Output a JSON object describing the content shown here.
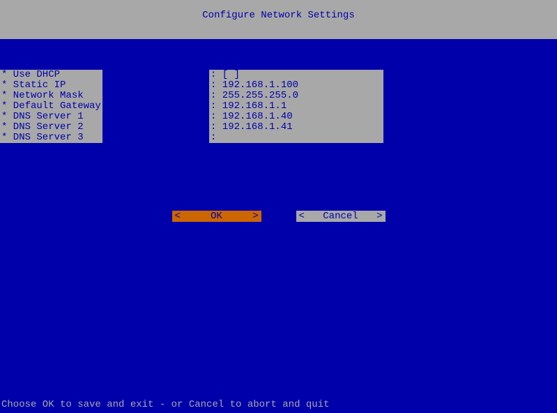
{
  "title": "Configure Network Settings",
  "fields": [
    {
      "label": "* Use DHCP",
      "value": ": [ ]"
    },
    {
      "label": "* Static IP",
      "value": ": 192.168.1.100"
    },
    {
      "label": "* Network Mask",
      "value": ": 255.255.255.0"
    },
    {
      "label": "* Default Gateway",
      "value": ": 192.168.1.1"
    },
    {
      "label": "* DNS Server 1",
      "value": ": 192.168.1.40"
    },
    {
      "label": "* DNS Server 2",
      "value": ": 192.168.1.41"
    },
    {
      "label": "* DNS Server 3",
      "value": ":"
    }
  ],
  "buttons": {
    "ok": "OK",
    "cancel": "Cancel",
    "bracket_l": "<",
    "bracket_r": ">"
  },
  "footer": "Choose OK to save and exit - or Cancel to abort and quit"
}
